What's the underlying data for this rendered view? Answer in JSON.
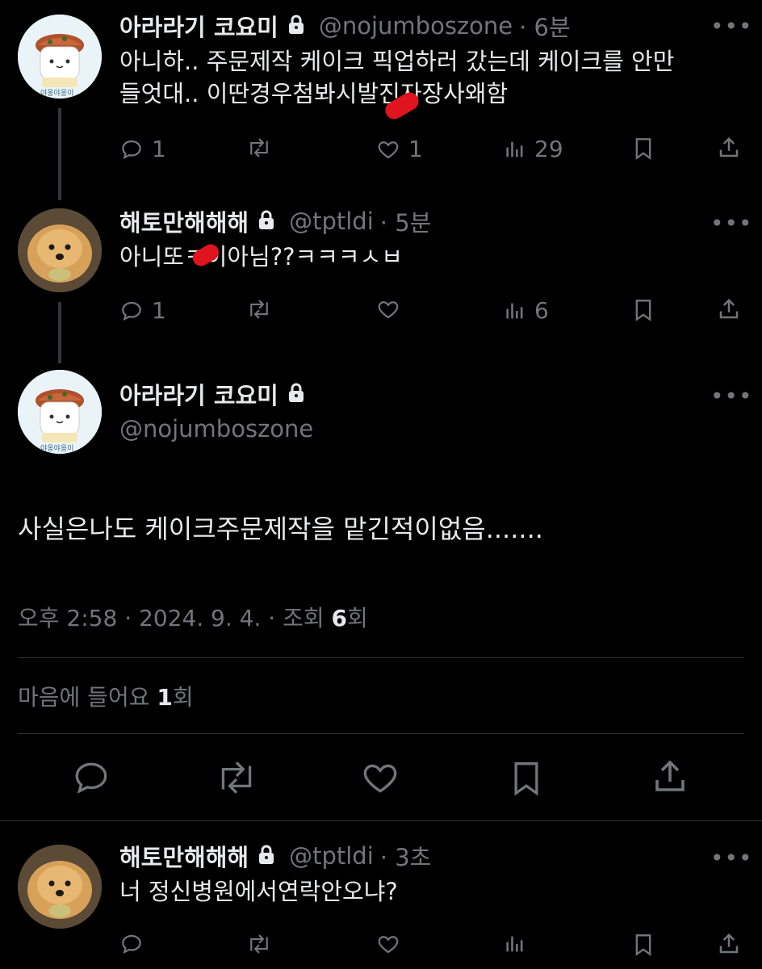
{
  "tweets": [
    {
      "name": "아라라기 코요미",
      "handle": "@nojumboszone",
      "time": "· 6분",
      "text_line1": "아니하.. 주문제작 케이크 픽업하러 갔는데 케이크를 안만",
      "text_line2": "들엇대.. 이딴경우첨봐시발진자장사왜함",
      "reply_count": "1",
      "retweet_count": "",
      "like_count": "1",
      "view_count": "29",
      "avatar_caption": "야옹야옹이"
    },
    {
      "name": "해토만해해해",
      "handle": "@tptldi",
      "time": "· 5분",
      "text_line1": "아니또ㅋ이아님??ㅋㅋㅋㅅㅂ",
      "reply_count": "1",
      "retweet_count": "",
      "like_count": "",
      "view_count": "6"
    }
  ],
  "main_tweet": {
    "name": "아라라기 코요미",
    "handle": "@nojumboszone",
    "avatar_caption": "야옹야옹이",
    "text": "사실은나도 케이크주문제작을 맡긴적이없음.......",
    "meta_prefix": "오후 2:58 · 2024. 9. 4. · 조회 ",
    "meta_views": "6",
    "meta_suffix": "회",
    "likes_prefix": "마음에 들어요 ",
    "likes_count": "1",
    "likes_suffix": "회"
  },
  "reply": {
    "name": "해토만해해해",
    "handle": "@tptldi",
    "time": "· 3초",
    "text": "너 정신병원에서연락안오냐?",
    "reply_count": "",
    "retweet_count": "",
    "like_count": "",
    "view_count": ""
  },
  "more_icon": "•••",
  "icons": [
    "reply-icon",
    "retweet-icon",
    "like-icon",
    "views-icon",
    "bookmark-icon",
    "share-icon",
    "lock-icon",
    "more-icon"
  ],
  "colors": {
    "background": "#000000",
    "text": "#e7e9ea",
    "muted": "#71767b",
    "divider": "#2f3336"
  }
}
